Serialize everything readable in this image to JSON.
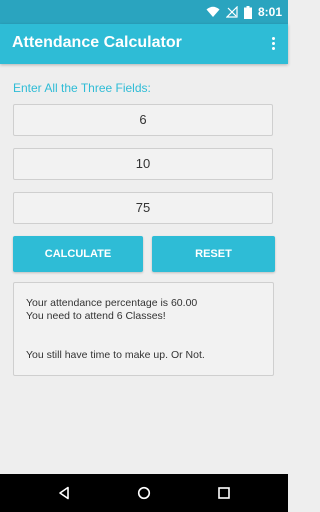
{
  "status_bar": {
    "time": "8:01",
    "icons": [
      "wifi-icon",
      "signal-off-icon",
      "battery-icon"
    ]
  },
  "app_bar": {
    "title": "Attendance Calculator",
    "menu_icon": "overflow-menu-icon"
  },
  "form": {
    "instruction": "Enter All the Three Fields:",
    "fields": [
      {
        "value": "6"
      },
      {
        "value": "10"
      },
      {
        "value": "75"
      }
    ],
    "calculate_label": "CALCULATE",
    "reset_label": "RESET"
  },
  "result": {
    "percentage_line": "Your attendance percentage is 60.00",
    "classes_line": "You need to attend 6 Classes!",
    "advice_line": "You still have time to make up. Or Not."
  },
  "nav_bar": {
    "icons": [
      "back-icon",
      "home-icon",
      "recents-icon"
    ]
  },
  "colors": {
    "primary": "#2ebcd6",
    "primary_dark": "#2aa4bf",
    "background": "#eeeeee"
  }
}
